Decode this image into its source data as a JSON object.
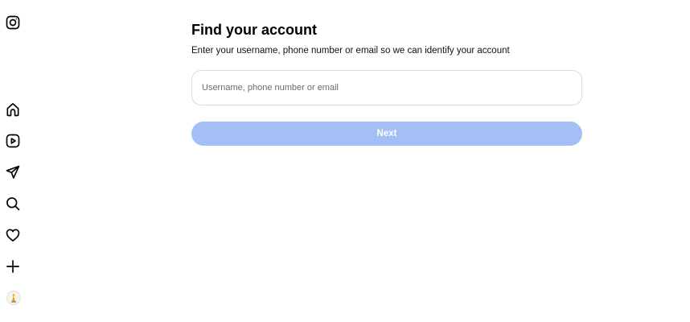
{
  "sidebar": {
    "icons": [
      {
        "name": "instagram-logo-icon"
      },
      {
        "name": "home-icon"
      },
      {
        "name": "reels-icon"
      },
      {
        "name": "messages-icon"
      },
      {
        "name": "search-icon"
      },
      {
        "name": "notifications-heart-icon"
      },
      {
        "name": "create-plus-icon"
      },
      {
        "name": "profile-avatar"
      }
    ]
  },
  "main": {
    "title": "Find your account",
    "subtitle": "Enter your username, phone number or email so we can identify your account",
    "search_input": {
      "placeholder": "Username, phone number or email",
      "value": ""
    },
    "next_label": "Next"
  },
  "colors": {
    "button_disabled": "#a3bff5",
    "input_border": "#dbdbdb",
    "text": "#000000"
  }
}
